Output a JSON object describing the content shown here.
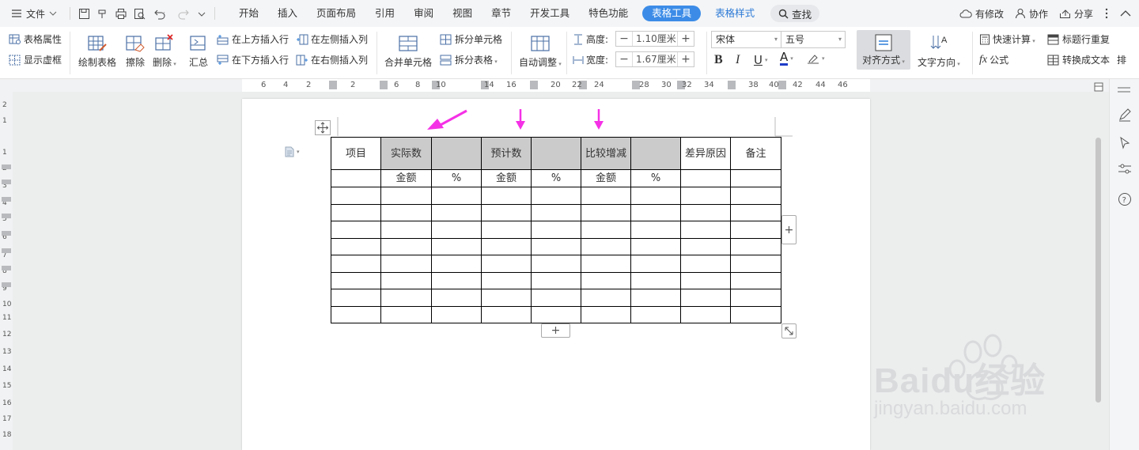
{
  "menubar": {
    "file": "文件",
    "tabs": [
      "开始",
      "插入",
      "页面布局",
      "引用",
      "审阅",
      "视图",
      "章节",
      "开发工具",
      "特色功能"
    ],
    "active_tab": "表格工具",
    "style_tab": "表格样式",
    "search": "查找",
    "right": {
      "modified": "有修改",
      "collab": "协作",
      "share": "分享"
    }
  },
  "ribbon": {
    "table_props": "表格属性",
    "show_gridlines": "显示虚框",
    "draw_table": "绘制表格",
    "erase": "擦除",
    "delete": "删除",
    "summary": "汇总",
    "insert_row_above": "在上方插入行",
    "insert_row_below": "在下方插入行",
    "insert_col_left": "在左侧插入列",
    "insert_col_right": "在右侧插入列",
    "merge_cells": "合并单元格",
    "split_cells": "拆分单元格",
    "split_table": "拆分表格",
    "auto_fit": "自动调整",
    "height_label": "高度:",
    "height_value": "1.10厘米",
    "width_label": "宽度:",
    "width_value": "1.67厘米",
    "font_name": "宋体",
    "font_size": "五号",
    "bold": "B",
    "italic": "I",
    "underline": "U",
    "font_color": "A",
    "align": "对齐方式",
    "text_direction": "文字方向",
    "quick_calc": "快速计算",
    "formula": "公式",
    "repeat_header": "标题行重复",
    "convert_text": "转换成文本",
    "sort_partial": "排"
  },
  "ruler": {
    "h_ticks": [
      "6",
      "4",
      "2",
      "2",
      "6",
      "8",
      "10",
      "14",
      "16",
      "20",
      "22",
      "24",
      "28",
      "30",
      "32",
      "34",
      "38",
      "40",
      "42",
      "44",
      "46"
    ],
    "v_ticks": [
      "2",
      "1",
      "1",
      "2",
      "3",
      "4",
      "5",
      "6",
      "7",
      "8",
      "9",
      "10",
      "11",
      "12",
      "13",
      "14",
      "15",
      "16",
      "17",
      "18"
    ]
  },
  "table": {
    "row1": [
      "项目",
      "实际数",
      "",
      "预计数",
      "",
      "比较增减",
      "",
      "差异原因",
      "备注"
    ],
    "row2": [
      "",
      "金额",
      "%",
      "金额",
      "%",
      "金额",
      "%",
      "",
      ""
    ],
    "empty_rows": 8,
    "gray_cols": [
      1,
      2,
      3,
      4,
      5,
      6
    ]
  },
  "colors": {
    "accent": "#3c8ce7",
    "arrow": "#f531e6",
    "header_fill": "#cbcbcb"
  },
  "watermark": {
    "brand": "Baidu经验",
    "url": "jingyan.baidu.com"
  }
}
